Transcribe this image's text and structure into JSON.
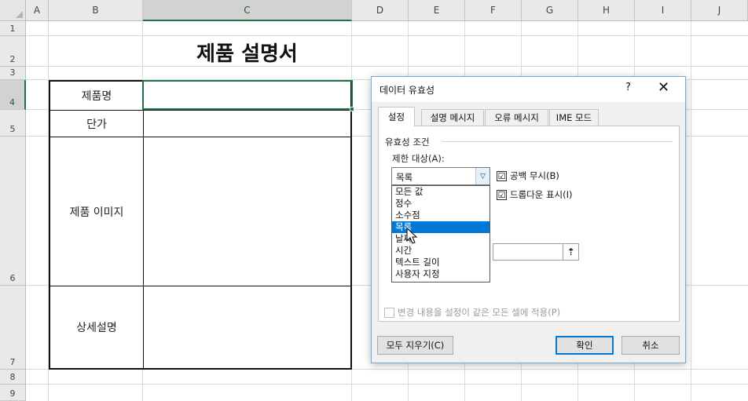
{
  "sheet": {
    "columns": [
      "A",
      "B",
      "C",
      "D",
      "E",
      "F",
      "G",
      "H",
      "I",
      "J"
    ],
    "selected_column": "C",
    "rows": [
      "1",
      "2",
      "3",
      "4",
      "5",
      "6",
      "7",
      "8",
      "9"
    ],
    "selected_row": "4",
    "title": "제품 설명서",
    "labels": {
      "product_name": "제품명",
      "unit_price": "단가",
      "product_image": "제품 이미지",
      "description": "상세설명"
    }
  },
  "dialog": {
    "title": "데이터 유효성",
    "help": "?",
    "close": "✕",
    "tabs": [
      "설정",
      "설명 메시지",
      "오류 메시지",
      "IME 모드"
    ],
    "active_tab": "설정",
    "group_label": "유효성 조건",
    "allow_label": "제한 대상(A):",
    "allow_value": "목록",
    "dropdown_arrow": "▽",
    "ignore_blank": {
      "label": "공백 무시(B)",
      "mark": "☑"
    },
    "in_cell_dropdown": {
      "label": "드롭다운 표시(I)",
      "mark": "☑"
    },
    "options": [
      "모든 값",
      "정수",
      "소수점",
      "목록",
      "날짜",
      "시간",
      "텍스트 길이",
      "사용자 지정"
    ],
    "selected_option": "목록",
    "ref_icon": "⇡",
    "apply_all": {
      "label": "변경 내용을 설정이 같은 모든 셀에 적용(P)"
    },
    "buttons": {
      "clear_all": "모두 지우기(C)",
      "ok": "확인",
      "cancel": "취소"
    }
  }
}
